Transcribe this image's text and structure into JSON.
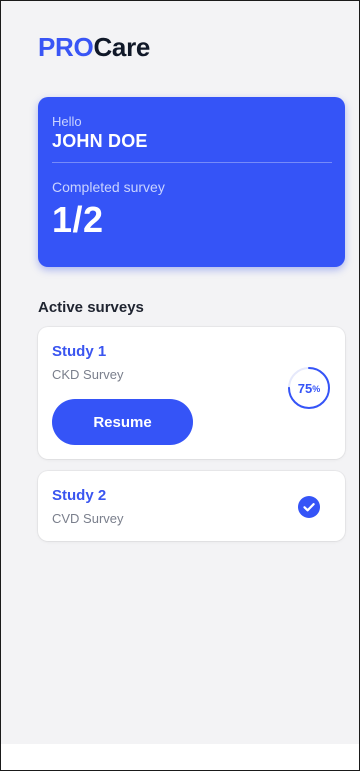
{
  "brand": {
    "prefix": "PRO",
    "suffix": "Care"
  },
  "summary": {
    "greeting": "Hello",
    "user_name": "JOHN DOE",
    "completed_label": "Completed survey",
    "completed_value": "1/2"
  },
  "active_surveys": {
    "title": "Active surveys",
    "items": [
      {
        "title": "Study 1",
        "subtitle": "CKD Survey",
        "progress_percent": 75,
        "progress_value": "75",
        "progress_unit": "%",
        "button_label": "Resume",
        "status": "in-progress"
      },
      {
        "title": "Study 2",
        "subtitle": "CVD Survey",
        "status": "completed",
        "status_icon": "check-circle-icon"
      }
    ]
  },
  "colors": {
    "accent": "#3554F7",
    "background": "#F3F3F5",
    "card": "#FFFFFF",
    "heading": "#101828",
    "muted": "#7A7F8C"
  }
}
